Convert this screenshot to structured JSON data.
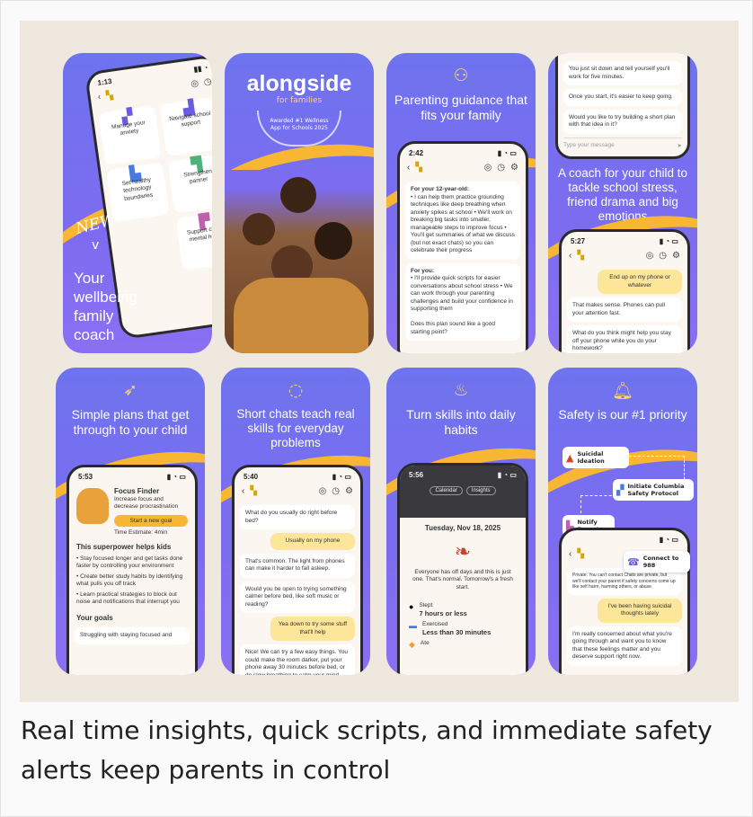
{
  "caption": "Real time insights, quick scripts, and immediate safety alerts keep parents in control",
  "colors": {
    "brand_purple": "#7c6cf0",
    "accent_yellow": "#f7b733",
    "panel_bg": "#efe8df"
  },
  "card1": {
    "status_time": "1:13",
    "tiles": [
      "Manage your anxiety",
      "Navigate school support",
      "Set healthy technology boundaries",
      "Strengthen partner",
      "Support child's mental health"
    ],
    "new_badge": "NEW!",
    "headline": "Your wellbeing family coach"
  },
  "card2": {
    "logo": "alongside",
    "sub": "for families",
    "award": "Awarded #1 Wellness App for Schools 2025"
  },
  "card3": {
    "icon": "family-icon",
    "headline": "Parenting guidance that fits your family",
    "status_time": "2:42",
    "p1_title": "For your 12-year-old:",
    "p1_body": "• I can help them practice grounding techniques like deep breathing when anxiety spikes at school • We'll work on breaking big tasks into smaller, manageable steps to improve focus • You'll get summaries of what we discuss (but not exact chats) so you can celebrate their progress",
    "p2_title": "For you:",
    "p2_body": "• I'll provide quick scripts for easier conversations about school stress • We can work through your parenting challenges and build your confidence in supporting them",
    "question": "Does this plan sound like a good starting point?"
  },
  "card4": {
    "m1": "You just sit down and tell yourself you'll work for five minutes.",
    "m2": "Once you start, it's easier to keep going.",
    "m3": "Would you like to try building a short plan with that idea in it?",
    "input_placeholder": "Type your message",
    "headline": "A coach for your child to tackle school stress, friend drama and big emotions",
    "status_time": "5:27",
    "u1": "End up on my phone or whatever",
    "m4": "That makes sense. Phones can pull your attention fast.",
    "m5": "What do you think might help you stay off your phone while you do your homework?"
  },
  "card5": {
    "icon": "rocket-icon",
    "headline": "Simple plans that get through to your child",
    "status_time": "5:53",
    "title": "Focus Finder",
    "desc": "Increase focus and decrease procrastination",
    "cta": "Start a new goal",
    "time_est": "Time Estimate: 4min",
    "section": "This superpower helps kids",
    "bullets": [
      "Stay focused longer and get tasks done faster by controlling your environment",
      "Create better study habits by identifying what pulls you off track",
      "Learn practical strategies to block out noise and notifications that interrupt you"
    ],
    "goals_title": "Your goals",
    "goal1": "Struggling with staying focused and"
  },
  "card6": {
    "icon": "chat-bubble-icon",
    "headline": "Short chats teach real skills for everyday problems",
    "status_time": "5:40",
    "m1": "What do you usually do right before bed?",
    "u1": "Usually on my phone",
    "m2": "That's common. The light from phones can make it harder to fall asleep.",
    "m3": "Would you be open to trying something calmer before bed, like soft music or reading?",
    "u2": "Yea down to try some stuff that'll help",
    "m4": "Nice! We can try a few easy things. You could make the room darker, put your phone away 30 minutes before bed, or do slow breathing to calm your mind."
  },
  "card7": {
    "icon": "flame-icon",
    "headline": "Turn skills into daily habits",
    "status_time": "5:56",
    "tab1": "Calendar",
    "tab2": "Insights",
    "date": "Tuesday, Nov 18, 2025",
    "note": "Everyone has off days and this is just one. That's normal. Tomorrow's a fresh start.",
    "slept_label": "Slept",
    "slept_val": "7 hours or less",
    "ex_label": "Exercised",
    "ex_val": "Less than 30 minutes",
    "ate_label": "Ate"
  },
  "card8": {
    "icon": "bell-icon",
    "headline": "Safety is our #1 priority",
    "flow1": "Suicidal Ideation",
    "flow2": "Initiate Columbia Safety Protocol",
    "flow3": "Notify Parents",
    "flow4": "Connect to 988",
    "privacy": "Private: You can't contact Chats are private, but we'll contact your parent if safety concerns come up like self harm, harming others, or abuse.",
    "u1": "I've been having suicidal thoughts lately",
    "m1": "I'm really concerned about what you're going through and want you to know that these feelings matter and you deserve support right now."
  }
}
